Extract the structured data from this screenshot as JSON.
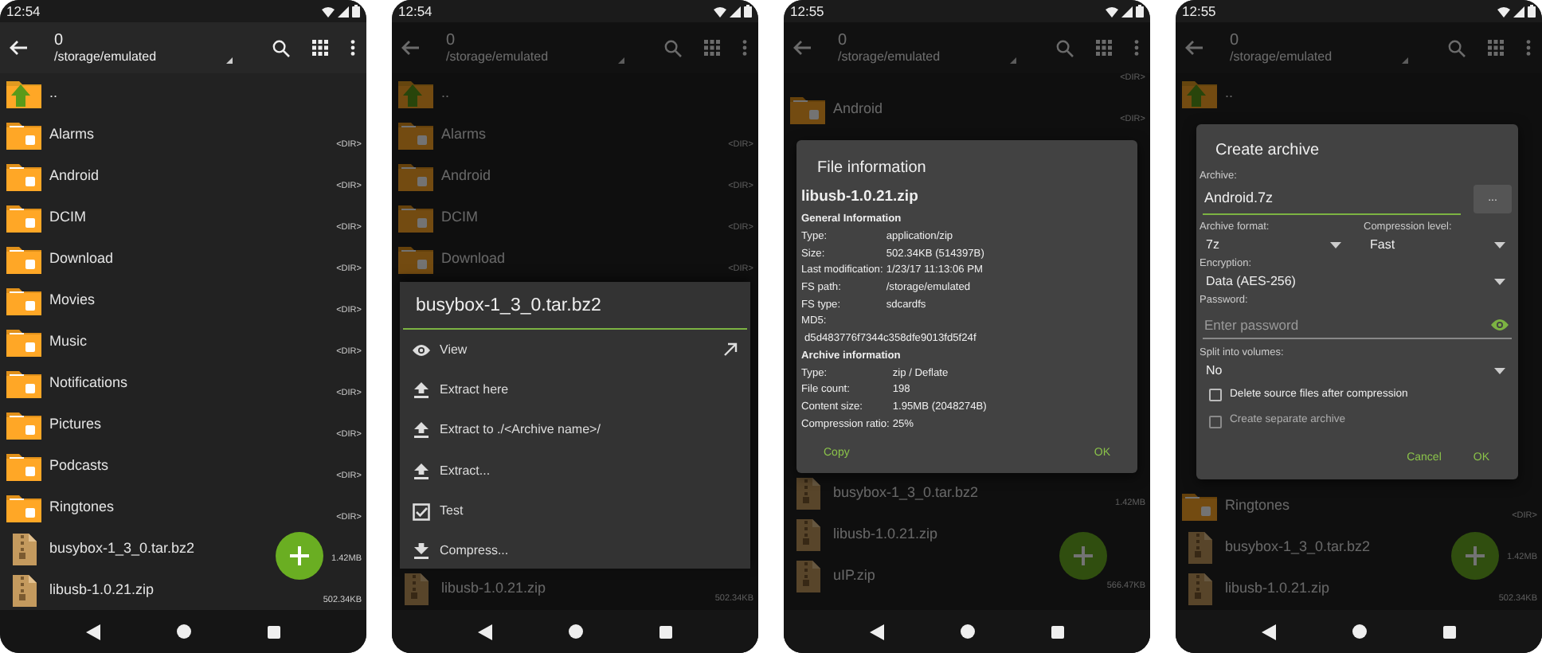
{
  "phones": [
    {
      "time": "12:54",
      "title": "0",
      "path": "/storage/emulated",
      "dimmed": false,
      "rows_above": [
        {
          "kind": "up",
          "name": ".."
        },
        {
          "kind": "folder",
          "name": "Alarms",
          "size": "<DIR>"
        },
        {
          "kind": "folder",
          "name": "Android",
          "size": "<DIR>"
        },
        {
          "kind": "folder",
          "name": "DCIM",
          "size": "<DIR>"
        },
        {
          "kind": "folder",
          "name": "Download",
          "size": "<DIR>"
        },
        {
          "kind": "folder",
          "name": "Movies",
          "size": "<DIR>"
        },
        {
          "kind": "folder",
          "name": "Music",
          "size": "<DIR>"
        },
        {
          "kind": "folder",
          "name": "Notifications",
          "size": "<DIR>"
        },
        {
          "kind": "folder",
          "name": "Pictures",
          "size": "<DIR>"
        },
        {
          "kind": "folder",
          "name": "Podcasts",
          "size": "<DIR>"
        },
        {
          "kind": "folder",
          "name": "Ringtones",
          "size": "<DIR>"
        },
        {
          "kind": "archive",
          "name": "busybox-1_3_0.tar.bz2",
          "size": "1.42MB"
        },
        {
          "kind": "archive",
          "name": "libusb-1.0.21.zip",
          "size": "502.34KB"
        }
      ]
    },
    {
      "time": "12:54",
      "title": "0",
      "path": "/storage/emulated",
      "dimmed": true,
      "rows_above": [
        {
          "kind": "up",
          "name": ".."
        },
        {
          "kind": "folder",
          "name": "Alarms",
          "size": "<DIR>"
        },
        {
          "kind": "folder",
          "name": "Android",
          "size": "<DIR>"
        },
        {
          "kind": "folder",
          "name": "DCIM",
          "size": "<DIR>"
        },
        {
          "kind": "folder",
          "name": "Download",
          "size": "<DIR>"
        }
      ],
      "overlay": {
        "kind": "actions",
        "title": "busybox-1_3_0.tar.bz2",
        "items": [
          {
            "kind": "view",
            "label": "View"
          },
          {
            "kind": "extract",
            "label": "Extract here"
          },
          {
            "kind": "extract",
            "label": "Extract to ./<Archive name>/"
          },
          {
            "kind": "extract",
            "label": "Extract..."
          },
          {
            "kind": "test",
            "label": "Test"
          },
          {
            "kind": "compress",
            "label": "Compress..."
          }
        ]
      },
      "rows_below": [
        {
          "kind": "archive",
          "name": "libusb-1.0.21.zip",
          "size": "502.34KB"
        }
      ]
    },
    {
      "time": "12:55",
      "title": "0",
      "path": "/storage/emulated",
      "dimmed": true,
      "rows_above": [
        {
          "size": "<DIR>"
        },
        {
          "kind": "folder",
          "name": "Android",
          "size": "<DIR>"
        }
      ],
      "overlay": {
        "kind": "info",
        "title": "File information",
        "file": "libusb-1.0.21.zip",
        "sections": [
          {
            "heading": "General Information",
            "fields": [
              {
                "kind": "inline",
                "label": "Type:",
                "value": "application/zip"
              },
              {
                "kind": "inline",
                "label": "Size:",
                "value": "502.34KB (514397B)"
              },
              {
                "kind": "inline",
                "label": "Last modification:",
                "value": "1/23/17 11:13:06 PM"
              },
              {
                "kind": "inline",
                "label": "FS path:",
                "value": "/storage/emulated"
              },
              {
                "kind": "inline",
                "label": "FS type:",
                "value": "sdcardfs"
              },
              {
                "kind": "block",
                "label": "MD5:",
                "value": "d5d483776f7344c358dfe9013fd5f24f"
              }
            ]
          },
          {
            "heading": "Archive information",
            "fields": [
              {
                "kind": "inline",
                "label": "Type:",
                "value": "zip / Deflate"
              },
              {
                "kind": "inline",
                "label": "File count:",
                "value": "198"
              },
              {
                "kind": "inline",
                "label": "Content size:",
                "value": "1.95MB (2048274B)"
              },
              {
                "kind": "inline",
                "label": "Compression ratio:",
                "value": "25%"
              }
            ]
          }
        ],
        "buttons": [
          "Copy",
          "OK"
        ]
      },
      "rows_below": [
        {
          "kind": "archive",
          "name": "busybox-1_3_0.tar.bz2",
          "size": "1.42MB"
        },
        {
          "kind": "archive",
          "name": "libusb-1.0.21.zip"
        },
        {
          "kind": "archive",
          "name": "uIP.zip",
          "size": "566.47KB"
        }
      ]
    },
    {
      "time": "12:55",
      "title": "0",
      "path": "/storage/emulated",
      "dimmed": true,
      "rows_above": [
        {
          "kind": "up",
          "name": ".."
        }
      ],
      "overlay": {
        "kind": "create",
        "title": "Create archive",
        "archive": {
          "label": "Archive:",
          "value": "Android.7z"
        },
        "browse": "...",
        "format": {
          "label": "Archive format:",
          "value": "7z"
        },
        "level": {
          "label": "Compression level:",
          "value": "Fast"
        },
        "encryption": {
          "label": "Encryption:",
          "value": "Data (AES-256)"
        },
        "password": {
          "label": "Password:",
          "placeholder": "Enter password"
        },
        "split": {
          "label": "Split into volumes:",
          "value": "No"
        },
        "options": [
          {
            "label": "Delete source files after compression",
            "checked": false,
            "disabled": false
          },
          {
            "label": "Create separate archive",
            "checked": false,
            "disabled": true
          }
        ],
        "buttons": [
          "Cancel",
          "OK"
        ]
      },
      "rows_below": [
        {
          "kind": "folder",
          "name": "Ringtones",
          "size": "<DIR>"
        },
        {
          "kind": "archive",
          "name": "busybox-1_3_0.tar.bz2",
          "size": "1.42MB"
        },
        {
          "kind": "archive",
          "name": "libusb-1.0.21.zip",
          "size": "502.34KB"
        }
      ]
    }
  ]
}
